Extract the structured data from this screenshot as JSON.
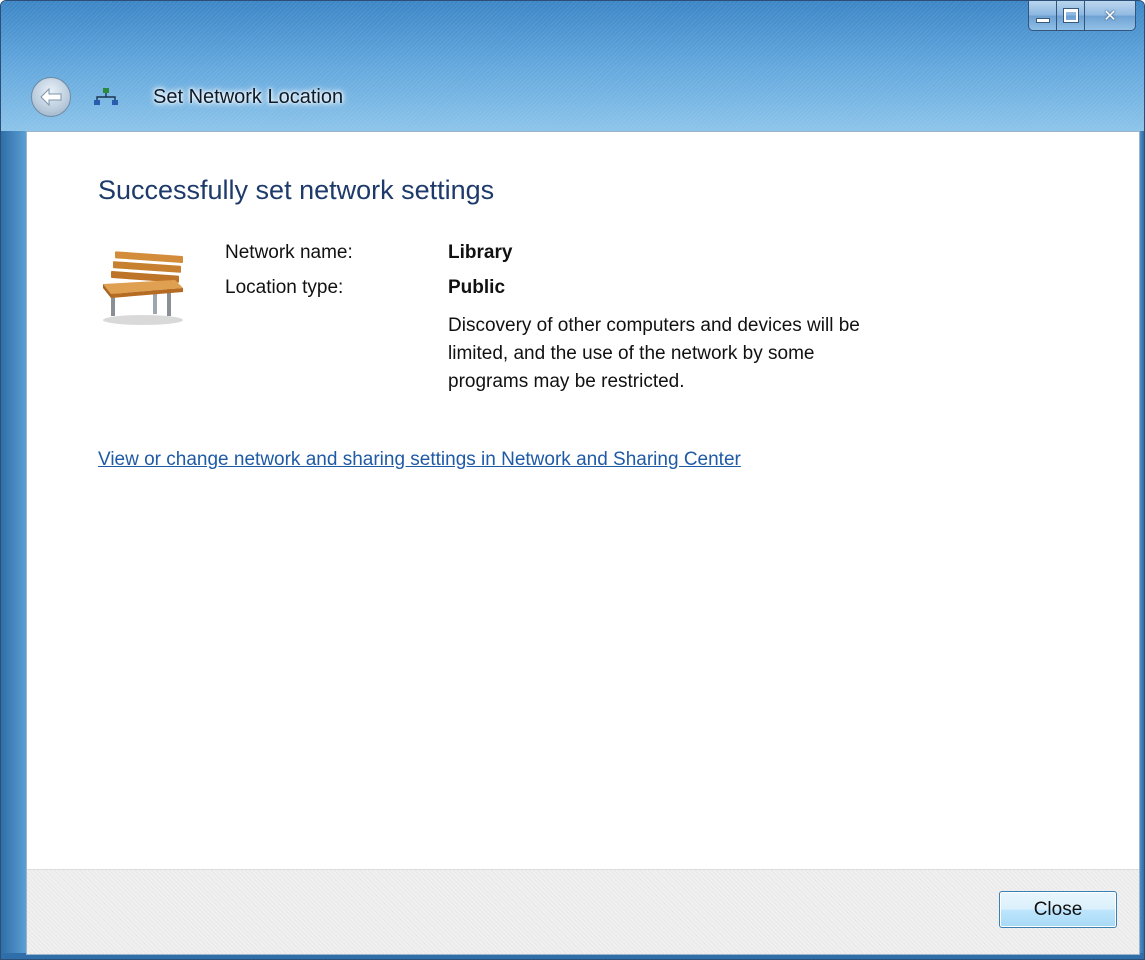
{
  "window": {
    "title": "Set Network Location"
  },
  "content": {
    "heading": "Successfully set network settings",
    "network_name_label": "Network name:",
    "network_name_value": "Library",
    "location_type_label": "Location type:",
    "location_type_value": "Public",
    "description": "Discovery of other computers and devices will be limited, and the use of the network by some programs may be restricted.",
    "link": "View or change network and sharing settings in Network and Sharing Center"
  },
  "footer": {
    "close_label": "Close"
  },
  "icons": {
    "back": "back-arrow-icon",
    "network": "network-icon",
    "location": "park-bench-icon"
  },
  "colors": {
    "heading": "#1e3a6a",
    "link": "#1f5aa6",
    "title_bar": "#5a98cd"
  }
}
